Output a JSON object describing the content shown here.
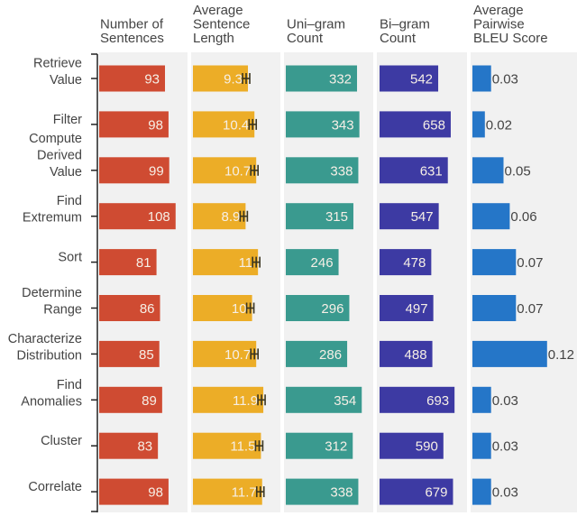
{
  "chart_data": {
    "type": "bar",
    "orientation": "horizontal",
    "layout": "small-multiples",
    "categories": [
      "Retrieve Value",
      "Filter",
      "Compute Derived Value",
      "Find Extremum",
      "Sort",
      "Determine Range",
      "Characterize Distribution",
      "Find Anomalies",
      "Cluster",
      "Correlate"
    ],
    "category_lines": [
      [
        "Retrieve",
        "Value"
      ],
      [
        "Filter"
      ],
      [
        "Compute",
        "Derived",
        "Value"
      ],
      [
        "Find",
        "Extremum"
      ],
      [
        "Sort"
      ],
      [
        "Determine",
        "Range"
      ],
      [
        "Characterize",
        "Distribution"
      ],
      [
        "Find",
        "Anomalies"
      ],
      [
        "Cluster"
      ],
      [
        "Correlate"
      ]
    ],
    "series": [
      {
        "name": "Number of Sentences",
        "header_lines": [
          "Number of",
          "Sentences"
        ],
        "color": "#cf4b32",
        "values": [
          93,
          98,
          99,
          108,
          81,
          86,
          85,
          89,
          83,
          98
        ],
        "labels": [
          "93",
          "98",
          "99",
          "108",
          "81",
          "86",
          "85",
          "89",
          "83",
          "98"
        ],
        "label_position": "inside",
        "xlim": [
          0,
          120
        ]
      },
      {
        "name": "Average Sentence Length",
        "header_lines": [
          "Average",
          "Sentence",
          "Length"
        ],
        "color": "#ecad27",
        "values": [
          9.3,
          10.4,
          10.7,
          8.9,
          11,
          10,
          10.7,
          11.9,
          11.5,
          11.7
        ],
        "labels": [
          "9.3",
          "10.4",
          "10.7",
          "8.9",
          "11",
          "10",
          "10.7",
          "11.9",
          "11.5",
          "11.7"
        ],
        "label_position": "inside",
        "error_bars": true,
        "xlim": [
          0,
          14
        ]
      },
      {
        "name": "Uni-gram Count",
        "header_lines": [
          "Uni–gram",
          "Count"
        ],
        "color": "#3a9a8f",
        "values": [
          332,
          343,
          338,
          315,
          246,
          296,
          286,
          354,
          312,
          338
        ],
        "labels": [
          "332",
          "343",
          "338",
          "315",
          "246",
          "296",
          "286",
          "354",
          "312",
          "338"
        ],
        "label_position": "inside",
        "xlim": [
          0,
          400
        ]
      },
      {
        "name": "Bi-gram Count",
        "header_lines": [
          "Bi–gram",
          "Count"
        ],
        "color": "#3d3aa3",
        "values": [
          542,
          658,
          631,
          547,
          478,
          497,
          488,
          693,
          590,
          679
        ],
        "labels": [
          "542",
          "658",
          "631",
          "547",
          "478",
          "497",
          "488",
          "693",
          "590",
          "679"
        ],
        "label_position": "inside",
        "xlim": [
          0,
          800
        ]
      },
      {
        "name": "Average Pairwise BLEU Score",
        "header_lines": [
          "Average",
          "Pairwise",
          "BLEU Score"
        ],
        "color": "#2576c8",
        "values": [
          0.03,
          0.02,
          0.05,
          0.06,
          0.07,
          0.07,
          0.12,
          0.03,
          0.03,
          0.03
        ],
        "labels": [
          "0.03",
          "0.02",
          "0.05",
          "0.06",
          "0.07",
          "0.07",
          "0.12",
          "0.03",
          "0.03",
          "0.03"
        ],
        "label_position": "outside",
        "xlim": [
          0,
          0.17
        ]
      }
    ],
    "title": "",
    "xlabel": "",
    "ylabel": "",
    "grid": false,
    "legend": "none"
  },
  "colors": {
    "panel_bg": "#f1f1f1",
    "axis": "#222222",
    "error_bar": "#3a3520"
  }
}
